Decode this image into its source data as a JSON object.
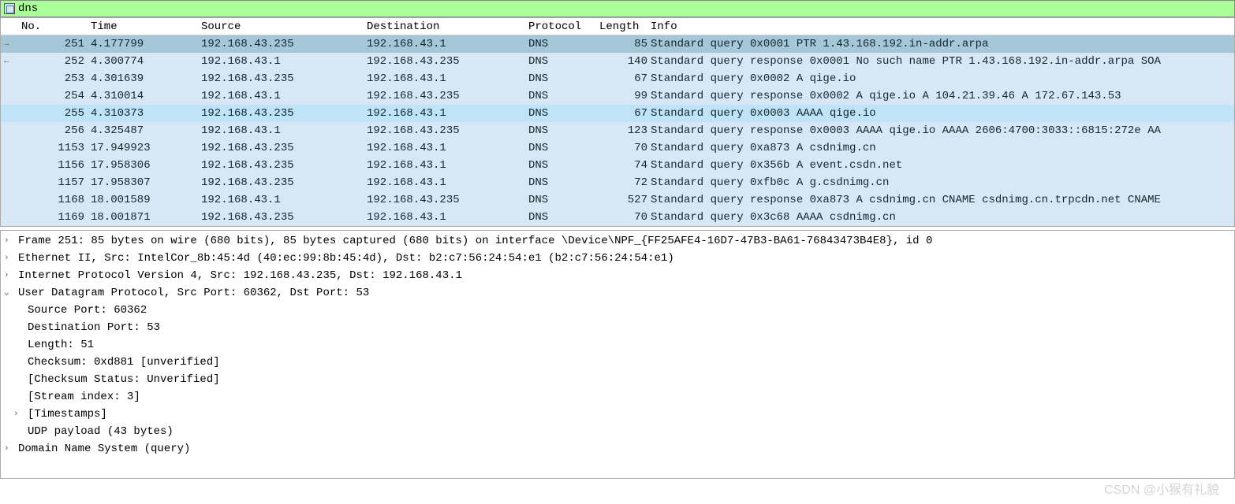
{
  "filter": {
    "value": "dns"
  },
  "columns": {
    "no": "No.",
    "time": "Time",
    "source": "Source",
    "destination": "Destination",
    "protocol": "Protocol",
    "length": "Length",
    "info": "Info"
  },
  "packets": [
    {
      "no": "251",
      "time": "4.177799",
      "src": "192.168.43.235",
      "dst": "192.168.43.1",
      "proto": "DNS",
      "len": "85",
      "info": "Standard query 0x0001 PTR 1.43.168.192.in-addr.arpa",
      "selected": true,
      "arrow": "out"
    },
    {
      "no": "252",
      "time": "4.300774",
      "src": "192.168.43.1",
      "dst": "192.168.43.235",
      "proto": "DNS",
      "len": "140",
      "info": "Standard query response 0x0001 No such name PTR 1.43.168.192.in-addr.arpa SOA",
      "arrow": "in"
    },
    {
      "no": "253",
      "time": "4.301639",
      "src": "192.168.43.235",
      "dst": "192.168.43.1",
      "proto": "DNS",
      "len": "67",
      "info": "Standard query 0x0002 A qige.io"
    },
    {
      "no": "254",
      "time": "4.310014",
      "src": "192.168.43.1",
      "dst": "192.168.43.235",
      "proto": "DNS",
      "len": "99",
      "info": "Standard query response 0x0002 A qige.io A 104.21.39.46 A 172.67.143.53"
    },
    {
      "no": "255",
      "time": "4.310373",
      "src": "192.168.43.235",
      "dst": "192.168.43.1",
      "proto": "DNS",
      "len": "67",
      "info": "Standard query 0x0003 AAAA qige.io",
      "highlight": true
    },
    {
      "no": "256",
      "time": "4.325487",
      "src": "192.168.43.1",
      "dst": "192.168.43.235",
      "proto": "DNS",
      "len": "123",
      "info": "Standard query response 0x0003 AAAA qige.io AAAA 2606:4700:3033::6815:272e AA"
    },
    {
      "no": "1153",
      "time": "17.949923",
      "src": "192.168.43.235",
      "dst": "192.168.43.1",
      "proto": "DNS",
      "len": "70",
      "info": "Standard query 0xa873 A csdnimg.cn"
    },
    {
      "no": "1156",
      "time": "17.958306",
      "src": "192.168.43.235",
      "dst": "192.168.43.1",
      "proto": "DNS",
      "len": "74",
      "info": "Standard query 0x356b A event.csdn.net"
    },
    {
      "no": "1157",
      "time": "17.958307",
      "src": "192.168.43.235",
      "dst": "192.168.43.1",
      "proto": "DNS",
      "len": "72",
      "info": "Standard query 0xfb0c A g.csdnimg.cn"
    },
    {
      "no": "1168",
      "time": "18.001589",
      "src": "192.168.43.1",
      "dst": "192.168.43.235",
      "proto": "DNS",
      "len": "527",
      "info": "Standard query response 0xa873 A csdnimg.cn CNAME csdnimg.cn.trpcdn.net CNAME"
    },
    {
      "no": "1169",
      "time": "18.001871",
      "src": "192.168.43.235",
      "dst": "192.168.43.1",
      "proto": "DNS",
      "len": "70",
      "info": "Standard query 0x3c68 AAAA csdnimg.cn"
    }
  ],
  "details": {
    "frame": "Frame 251: 85 bytes on wire (680 bits), 85 bytes captured (680 bits) on interface \\Device\\NPF_{FF25AFE4-16D7-47B3-BA61-76843473B4E8}, id 0",
    "ethernet": "Ethernet II, Src: IntelCor_8b:45:4d (40:ec:99:8b:45:4d), Dst: b2:c7:56:24:54:e1 (b2:c7:56:24:54:e1)",
    "ip": "Internet Protocol Version 4, Src: 192.168.43.235, Dst: 192.168.43.1",
    "udp": "User Datagram Protocol, Src Port: 60362, Dst Port: 53",
    "udp_children": {
      "src_port": "Source Port: 60362",
      "dst_port": "Destination Port: 53",
      "length": "Length: 51",
      "checksum": "Checksum: 0xd881 [unverified]",
      "checksum_status": "[Checksum Status: Unverified]",
      "stream": "[Stream index: 3]",
      "timestamps": "[Timestamps]",
      "payload": "UDP payload (43 bytes)"
    },
    "dns": "Domain Name System (query)"
  },
  "watermark": "CSDN @小猴有礼貌"
}
